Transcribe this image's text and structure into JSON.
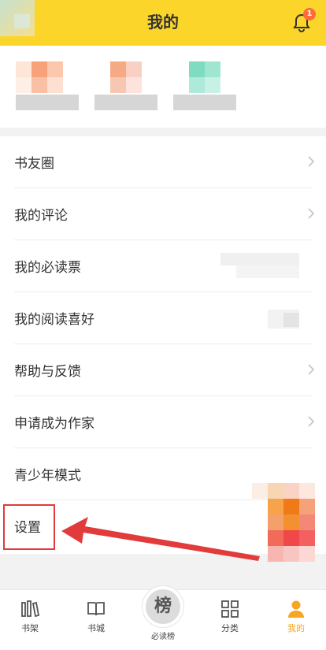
{
  "header": {
    "title": "我的",
    "bell_badge": "1",
    "icons": {
      "bell": "bell-icon"
    }
  },
  "menu": {
    "items": [
      {
        "label": "书友圈",
        "chevron": true
      },
      {
        "label": "我的评论",
        "chevron": true
      },
      {
        "label": "我的必读票",
        "chevron": false
      },
      {
        "label": "我的阅读喜好",
        "chevron": false
      },
      {
        "label": "帮助与反馈",
        "chevron": true
      },
      {
        "label": "申请成为作家",
        "chevron": true
      },
      {
        "label": "青少年模式",
        "chevron": false
      },
      {
        "label": "设置",
        "chevron": false
      }
    ]
  },
  "tabbar": {
    "tabs": [
      {
        "label": "书架",
        "icon": "bookshelf-icon"
      },
      {
        "label": "书城",
        "icon": "book-icon"
      },
      {
        "label": "必读榜",
        "icon": "ranking-icon",
        "glyph": "榜"
      },
      {
        "label": "分类",
        "icon": "category-grid-icon"
      },
      {
        "label": "我的",
        "icon": "user-icon",
        "active": true
      }
    ]
  },
  "colors": {
    "brand_yellow": "#fcd52b",
    "annotation_red": "#e03a3a",
    "active_tab": "#f5a623"
  }
}
